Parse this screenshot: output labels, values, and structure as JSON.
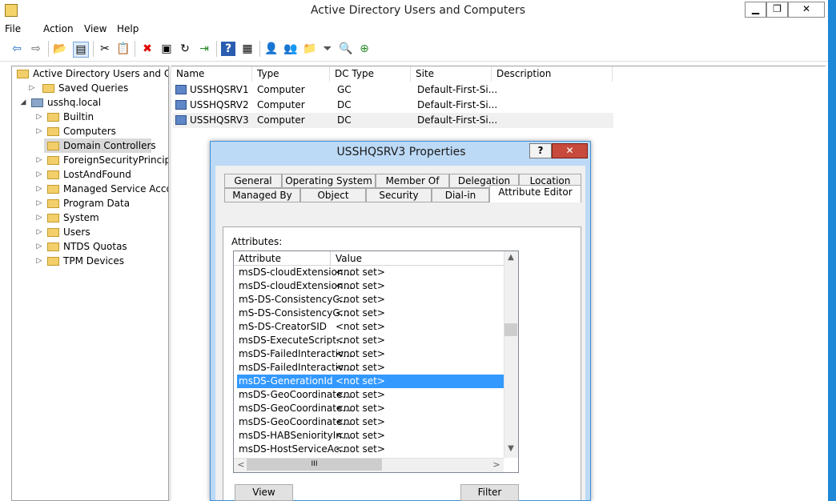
{
  "window": {
    "title": "Active Directory Users and Computers",
    "min_glyph": "▁",
    "max_glyph": "❐",
    "close_glyph": "✕"
  },
  "menu": [
    "File",
    "Action",
    "View",
    "Help"
  ],
  "toolbar": {
    "icons": [
      "back-arrow-icon",
      "forward-arrow-icon",
      "up-folder-icon",
      "show-tree-icon",
      "cut-icon",
      "paste-icon",
      "delete-icon",
      "properties-icon",
      "refresh-icon",
      "export-list-icon",
      "help-icon",
      "console-icon",
      "new-user-icon",
      "new-group-icon",
      "new-ou-icon",
      "filter-icon",
      "find-icon",
      "add-to-group-icon"
    ],
    "glyphs": [
      "⇦",
      "⇨",
      "📂",
      "▤",
      "✂",
      "📋",
      "✖",
      "▣",
      "↻",
      "⇥",
      "?",
      "▦",
      "👤",
      "👥",
      "📁",
      "⏷",
      "🔍",
      "⊕"
    ]
  },
  "tree": {
    "root": "Active Directory Users and Com",
    "items": [
      {
        "label": "Saved Queries",
        "expander": "▷",
        "level": 1
      },
      {
        "label": "usshq.local",
        "expander": "◢",
        "level": 1
      },
      {
        "label": "Builtin",
        "expander": "▷",
        "level": 2
      },
      {
        "label": "Computers",
        "expander": "▷",
        "level": 2
      },
      {
        "label": "Domain Controllers",
        "expander": "",
        "level": 2,
        "selected": true
      },
      {
        "label": "ForeignSecurityPrincipals",
        "expander": "▷",
        "level": 2
      },
      {
        "label": "LostAndFound",
        "expander": "▷",
        "level": 2
      },
      {
        "label": "Managed Service Accour",
        "expander": "▷",
        "level": 2
      },
      {
        "label": "Program Data",
        "expander": "▷",
        "level": 2
      },
      {
        "label": "System",
        "expander": "▷",
        "level": 2
      },
      {
        "label": "Users",
        "expander": "▷",
        "level": 2
      },
      {
        "label": "NTDS Quotas",
        "expander": "▷",
        "level": 2
      },
      {
        "label": "TPM Devices",
        "expander": "▷",
        "level": 2
      }
    ]
  },
  "list": {
    "columns": [
      "Name",
      "Type",
      "DC Type",
      "Site",
      "Description"
    ],
    "rows": [
      {
        "name": "USSHQSRV1",
        "type": "Computer",
        "dc_type": "GC",
        "site": "Default-First-Si...",
        "description": ""
      },
      {
        "name": "USSHQSRV2",
        "type": "Computer",
        "dc_type": "DC",
        "site": "Default-First-Si...",
        "description": ""
      },
      {
        "name": "USSHQSRV3",
        "type": "Computer",
        "dc_type": "DC",
        "site": "Default-First-Si...",
        "description": "",
        "selected": true
      }
    ]
  },
  "dialog": {
    "title": "USSHQSRV3 Properties",
    "help_glyph": "?",
    "close_glyph": "✕",
    "tabs_row1": [
      "General",
      "Operating System",
      "Member Of",
      "Delegation",
      "Location"
    ],
    "tabs_row2": [
      "Managed By",
      "Object",
      "Security",
      "Dial-in",
      "Attribute Editor"
    ],
    "active_tab": "Attribute Editor",
    "attributes_label": "Attributes:",
    "attr_columns": [
      "Attribute",
      "Value"
    ],
    "attributes": [
      {
        "name": "msDS-cloudExtension...",
        "value": "<not set>"
      },
      {
        "name": "msDS-cloudExtension...",
        "value": "<not set>"
      },
      {
        "name": "mS-DS-ConsistencyC...",
        "value": "<not set>"
      },
      {
        "name": "mS-DS-ConsistencyG...",
        "value": "<not set>"
      },
      {
        "name": "mS-DS-CreatorSID",
        "value": "<not set>"
      },
      {
        "name": "msDS-ExecuteScript...",
        "value": "<not set>"
      },
      {
        "name": "msDS-FailedInteractiv...",
        "value": "<not set>"
      },
      {
        "name": "msDS-FailedInteractiv...",
        "value": "<not set>"
      },
      {
        "name": "msDS-GenerationId",
        "value": "<not set>",
        "selected": true
      },
      {
        "name": "msDS-GeoCoordinate...",
        "value": "<not set>"
      },
      {
        "name": "msDS-GeoCoordinate...",
        "value": "<not set>"
      },
      {
        "name": "msDS-GeoCoordinate...",
        "value": "<not set>"
      },
      {
        "name": "msDS-HABSeniorityIn...",
        "value": "<not set>"
      },
      {
        "name": "msDS-HostServiceAc...",
        "value": "<not set>"
      }
    ],
    "scroll_up": "▲",
    "scroll_down": "▼",
    "scroll_left": "<",
    "scroll_right": ">",
    "hthumb_grip": "III",
    "view_button": "View",
    "filter_button": "Filter"
  },
  "colors": {
    "accent": "#3399ff",
    "dialog_frame": "#bcd9f5",
    "close": "#c74a3c"
  }
}
